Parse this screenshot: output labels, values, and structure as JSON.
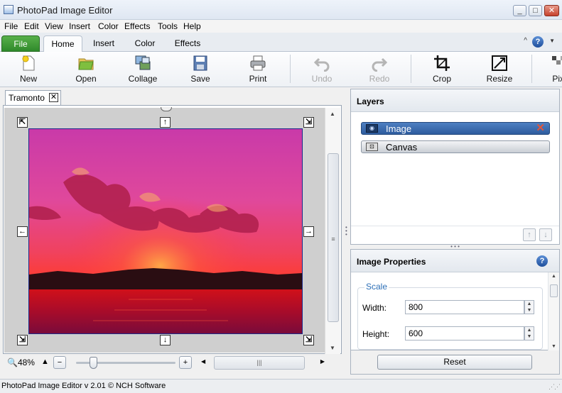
{
  "window": {
    "title": "PhotoPad Image Editor",
    "buttons": [
      "_",
      "□",
      "✕"
    ]
  },
  "menu": [
    "File",
    "Edit",
    "View",
    "Insert",
    "Color",
    "Effects",
    "Tools",
    "Help"
  ],
  "ribbon_tabs": {
    "file": "File",
    "items": [
      "Home",
      "Insert",
      "Color",
      "Effects"
    ],
    "active": "Home"
  },
  "help": {
    "collapse": "^",
    "help": "?",
    "dropdown": "▼"
  },
  "toolbar": {
    "new": "New",
    "open": "Open",
    "collage": "Collage",
    "save": "Save",
    "print": "Print",
    "undo": "Undo",
    "redo": "Redo",
    "crop": "Crop",
    "resize": "Resize",
    "pixelate": "Pixi"
  },
  "document": {
    "tab_name": "Tramonto",
    "tab_close": "✕",
    "zoom": "48%",
    "handles": {
      "tl": "⇱",
      "top": "↑",
      "tr": "⇲",
      "left": "←",
      "right": "→",
      "bl": "⇲",
      "bottom": "↓",
      "br": "⇲"
    }
  },
  "layers": {
    "header": "Layers",
    "items": [
      {
        "name": "Image",
        "selected": true
      },
      {
        "name": "Canvas",
        "selected": false
      }
    ],
    "delete": "✕",
    "move_up": "↑",
    "move_down": "↓"
  },
  "properties": {
    "header": "Image Properties",
    "help": "?",
    "group_label": "Scale",
    "width_label": "Width:",
    "width_value": "800",
    "height_label": "Height:",
    "height_value": "600",
    "reset": "Reset"
  },
  "status": {
    "text": "PhotoPad Image Editor v 2.01 © NCH Software"
  },
  "colors": {
    "file_tab": "#3a9a33",
    "selected_layer": "#3a6aae",
    "scale_label": "#2c6fb7",
    "layer_delete": "#e2553a"
  }
}
